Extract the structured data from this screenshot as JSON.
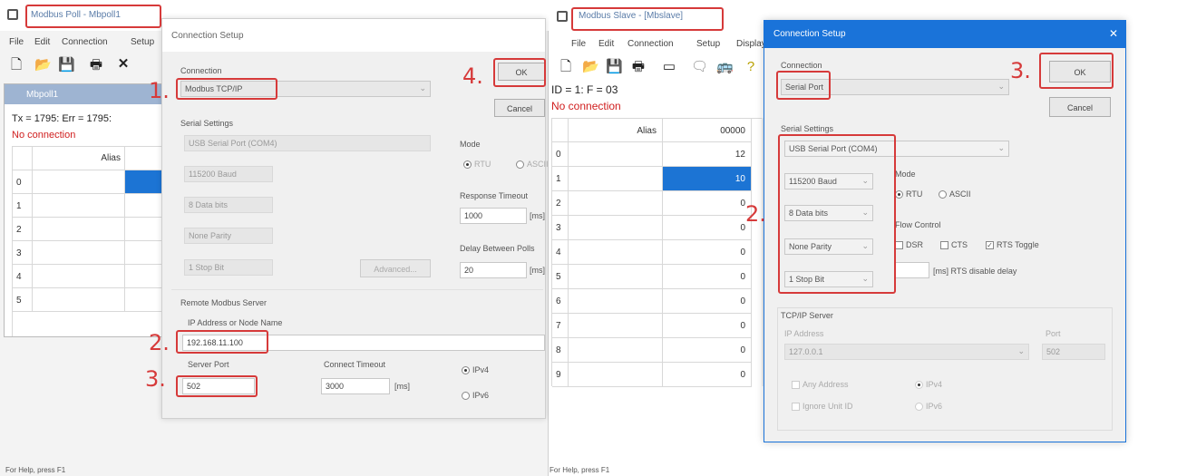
{
  "left": {
    "app_title": "Modbus Poll - Mbpoll1",
    "menu": [
      "File",
      "Edit",
      "Connection",
      "Setup"
    ],
    "toolbar_icons": [
      "new-icon",
      "open-icon",
      "save-icon",
      "print-icon",
      "delete-icon"
    ],
    "child_title": "Mbpoll1",
    "tx_line": "Tx = 1795: Err = 1795:",
    "no_connection": "No connection",
    "grid_header": "Alias",
    "rows": [
      "0",
      "1",
      "2",
      "3",
      "4",
      "5"
    ],
    "status_bar": "For Help, press F1",
    "dialog": {
      "title": "Connection Setup",
      "connection_label": "Connection",
      "connection_value": "Modbus TCP/IP",
      "serial_settings_label": "Serial Settings",
      "serial_port": "USB Serial Port (COM4)",
      "baud": "115200 Baud",
      "data_bits": "8 Data bits",
      "parity": "None Parity",
      "stop_bit": "1 Stop Bit",
      "advanced": "Advanced...",
      "mode_label": "Mode",
      "mode_rtu": "RTU",
      "mode_ascii": "ASCII",
      "response_timeout_label": "Response Timeout",
      "response_timeout_value": "1000",
      "response_timeout_unit": "[ms]",
      "delay_label": "Delay Between Polls",
      "delay_value": "20",
      "delay_unit": "[ms]",
      "remote_server_label": "Remote Modbus Server",
      "ip_label": "IP Address or Node Name",
      "ip_value": "192.168.11.100",
      "server_port_label": "Server Port",
      "server_port_value": "502",
      "connect_timeout_label": "Connect Timeout",
      "connect_timeout_value": "3000",
      "connect_timeout_unit": "[ms]",
      "ipv4": "IPv4",
      "ipv6": "IPv6",
      "ok": "OK",
      "cancel": "Cancel"
    },
    "steps": [
      "1.",
      "2.",
      "3.",
      "4."
    ]
  },
  "right": {
    "app_title": "Modbus Slave - [Mbslave]",
    "menu": [
      "File",
      "Edit",
      "Connection",
      "Setup",
      "Display"
    ],
    "toolbar_icons": [
      "new-icon",
      "open-icon",
      "save-icon",
      "print-icon",
      "window-icon",
      "comment-icon",
      "bus-icon",
      "help-icon"
    ],
    "id_line": "ID = 1: F = 03",
    "no_connection": "No connection",
    "grid_header_alias": "Alias",
    "grid_header_col": "00000",
    "rows": [
      "0",
      "1",
      "2",
      "3",
      "4",
      "5",
      "6",
      "7",
      "8",
      "9"
    ],
    "values": [
      "12",
      "10",
      "0",
      "0",
      "0",
      "0",
      "0",
      "0",
      "0",
      "0"
    ],
    "status_bar": "For Help, press F1",
    "dialog": {
      "title": "Connection Setup",
      "close": "✕",
      "connection_label": "Connection",
      "connection_value": "Serial Port",
      "serial_settings_label": "Serial Settings",
      "serial_port": "USB Serial Port (COM4)",
      "baud": "115200 Baud",
      "data_bits": "8 Data bits",
      "parity": "None Parity",
      "stop_bit": "1 Stop Bit",
      "mode_label": "Mode",
      "mode_rtu": "RTU",
      "mode_ascii": "ASCII",
      "flow_label": "Flow Control",
      "dsr": "DSR",
      "cts": "CTS",
      "rts": "RTS Toggle",
      "rts_delay": "[ms] RTS disable delay",
      "tcp_label": "TCP/IP Server",
      "ip_label": "IP Address",
      "ip_value": "127.0.0.1",
      "port_label": "Port",
      "port_value": "502",
      "any_address": "Any Address",
      "ignore_unit": "Ignore Unit ID",
      "ipv4": "IPv4",
      "ipv6": "IPv6",
      "ok": "OK",
      "cancel": "Cancel"
    },
    "steps": [
      "2.",
      "3."
    ]
  },
  "colors": {
    "annotation_red": "#d63a3a",
    "dialog_title_blue": "#1a73d9",
    "selected_cell": "#1c74d4"
  }
}
